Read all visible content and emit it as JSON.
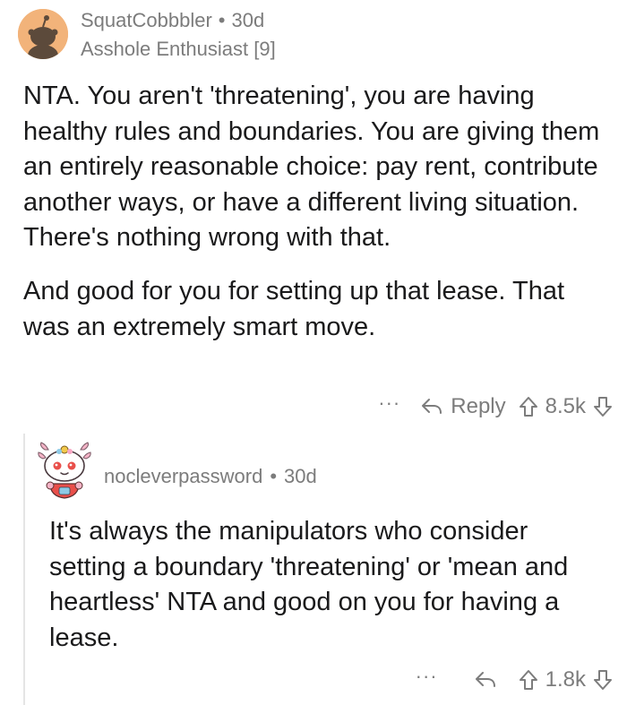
{
  "parent_comment": {
    "username": "SquatCobbbler",
    "age": "30d",
    "flair": "Asshole Enthusiast [9]",
    "paragraphs": [
      "NTA. You aren't 'threatening', you are having healthy rules and boundaries. You are giving them an entirely reasonable choice: pay rent, contribute another ways, or have a different living situation. There's nothing wrong with that.",
      "And good for you for setting up that lease. That was an extremely smart move."
    ],
    "actions": {
      "more": "···",
      "reply_label": "Reply",
      "score": "8.5k"
    }
  },
  "child_comment": {
    "username": "nocleverpassword",
    "age": "30d",
    "text": "It's always the manipulators who consider setting a boundary 'threatening' or 'mean and heartless' NTA and good on you for having a lease.",
    "actions": {
      "more": "···",
      "score": "1.8k"
    }
  },
  "separator": "•",
  "icons": {
    "reply": "reply-arrow-icon",
    "upvote": "upvote-arrow-icon",
    "downvote": "downvote-arrow-icon",
    "avatar_parent": "snoo-avatar-icon",
    "avatar_child": "snoo-axolotl-avatar-icon"
  },
  "colors": {
    "meta_text": "#7c7c7c",
    "body_text": "#1a1a1b",
    "avatar_bg": "#f2b37a",
    "thread_line": "#e5e5e5"
  }
}
